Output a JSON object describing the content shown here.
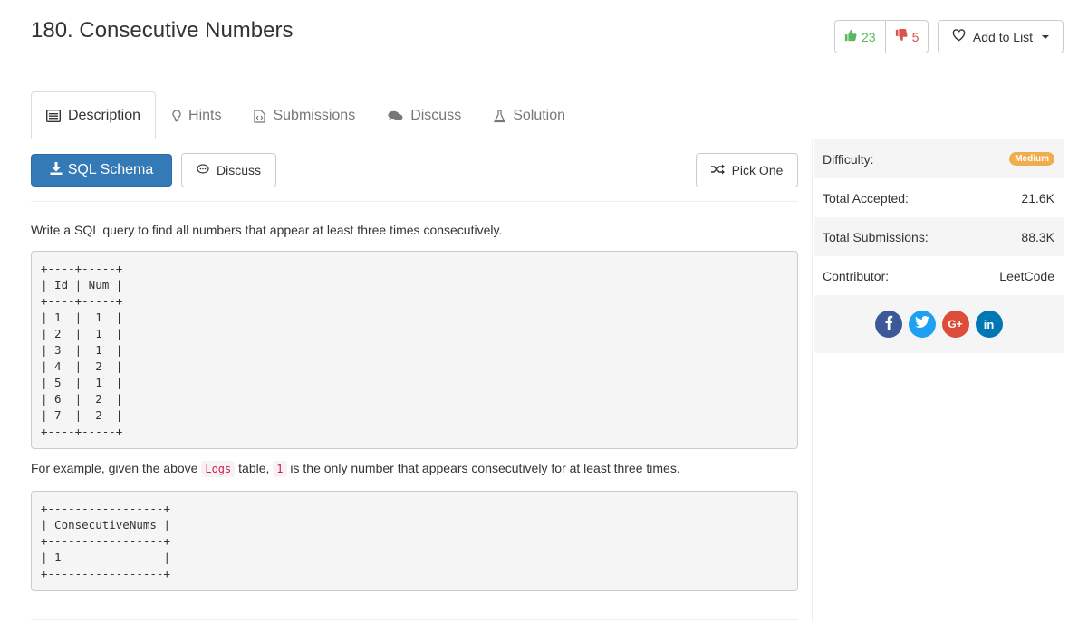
{
  "problem": {
    "title": "180. Consecutive Numbers"
  },
  "votes": {
    "up": "23",
    "down": "5",
    "up_color": "#5cb85c",
    "down_color": "#d9534f"
  },
  "add_to_list": "Add to List",
  "tabs": [
    {
      "label": "Description",
      "icon": "description-icon"
    },
    {
      "label": "Hints",
      "icon": "lightbulb-icon"
    },
    {
      "label": "Submissions",
      "icon": "code-file-icon"
    },
    {
      "label": "Discuss",
      "icon": "comments-icon"
    },
    {
      "label": "Solution",
      "icon": "flask-icon"
    }
  ],
  "toolbar": {
    "sql_schema": "SQL Schema",
    "discuss": "Discuss",
    "pick_one": "Pick One",
    "primary_color": "#337ab7"
  },
  "content": {
    "intro": "Write a SQL query to find all numbers that appear at least three times consecutively.",
    "table1": "+----+-----+\n| Id | Num |\n+----+-----+\n| 1  |  1  |\n| 2  |  1  |\n| 3  |  1  |\n| 4  |  2  |\n| 5  |  1  |\n| 6  |  2  |\n| 7  |  2  |\n+----+-----+",
    "example_prefix": "For example, given the above ",
    "example_code1": "Logs",
    "example_middle": " table, ",
    "example_code2": "1",
    "example_suffix": " is the only number that appears consecutively for at least three times.",
    "table2": "+-----------------+\n| ConsecutiveNums |\n+-----------------+\n| 1               |\n+-----------------+"
  },
  "sidebar": {
    "difficulty_label": "Difficulty:",
    "difficulty_value": "Medium",
    "difficulty_color": "#f0ad4e",
    "accepted_label": "Total Accepted:",
    "accepted_value": "21.6K",
    "submissions_label": "Total Submissions:",
    "submissions_value": "88.3K",
    "contributor_label": "Contributor:",
    "contributor_value": "LeetCode",
    "share": [
      {
        "name": "facebook-icon",
        "glyph": "f",
        "color": "#3b5998"
      },
      {
        "name": "twitter-icon",
        "glyph": "t",
        "color": "#1da1f2"
      },
      {
        "name": "google-plus-icon",
        "glyph": "G+",
        "color": "#dd4b39"
      },
      {
        "name": "linkedin-icon",
        "glyph": "in",
        "color": "#0077b5"
      }
    ]
  }
}
